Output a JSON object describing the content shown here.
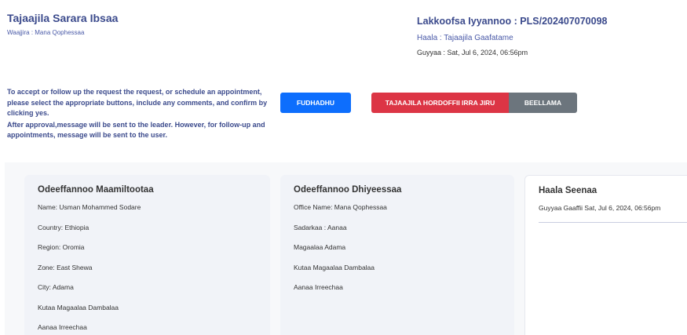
{
  "header": {
    "title": "Tajaajila Sarara Ibsaa",
    "subtitle": "Waajjira : Mana Qophessaa"
  },
  "meta": {
    "request_number": "Lakkoofsa Iyyannoo : PLS/202407070098",
    "status": "Haala : Tajaajila Gaafatame",
    "date": "Guyyaa : Sat, Jul 6, 2024, 06:56pm"
  },
  "instructions": {
    "line1": "To accept or follow up the request the request, or schedule an appointment, please select the appropriate buttons, include any comments, and confirm by clicking yes.",
    "line2": "After approval,message will be sent to the leader. However, for follow-up and appointments, message will be sent to the user."
  },
  "actions": {
    "accept_label": "FUDHADHU",
    "reject_label": "TAJAAJILA HORDOFFII IRRA JIRU",
    "schedule_label": "BEELLAMA"
  },
  "customer_card": {
    "title": "Odeeffannoo Maamiltootaa",
    "rows": [
      "Name: Usman Mohammed Sodare",
      "Country: Ethiopia",
      "Region: Oromia",
      "Zone: East Shewa",
      "City: Adama",
      "Kutaa Magaalaa Dambalaa",
      "Aanaa Irreechaa"
    ]
  },
  "service_card": {
    "title": "Odeeffannoo Dhiyeessaa",
    "rows": [
      "Office Name: Mana Qophessaa",
      "Sadarkaa : Aanaa",
      "Magaalaa Adama",
      "Kutaa Magaalaa Dambalaa",
      "Aanaa Irreechaa"
    ]
  },
  "status_card": {
    "title": "Haala Seenaa",
    "date": "Guyyaa Gaaffii Sat, Jul 6, 2024, 06:56pm"
  },
  "colors": {
    "accept": "#0d6efd",
    "reject": "#dc3545",
    "schedule": "#6c757d",
    "heading": "#3b4a8c"
  }
}
